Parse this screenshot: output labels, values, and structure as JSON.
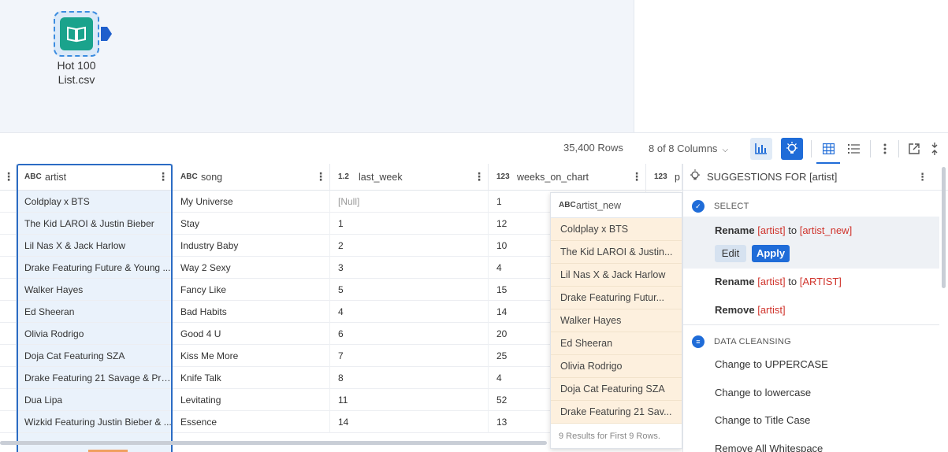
{
  "canvas": {
    "tool": {
      "label": "Hot 100\nList.csv",
      "icon": "book-open-icon"
    }
  },
  "toolbar": {
    "rows": "35,400 Rows",
    "columns": "8 of 8 Columns",
    "icons": [
      "bar-chart-icon",
      "lightbulb-icon",
      "grid-view-icon",
      "list-view-icon",
      "more-icon",
      "pop-out-icon",
      "collapse-icon"
    ]
  },
  "grid": {
    "headers": [
      {
        "type": "ABC",
        "name": "artist"
      },
      {
        "type": "ABC",
        "name": "song"
      },
      {
        "type": "1.2",
        "name": "last_week"
      },
      {
        "type": "123",
        "name": "weeks_on_chart"
      },
      {
        "type": "123",
        "name": "p"
      }
    ],
    "rows": [
      [
        "Coldplay x BTS",
        "My Universe",
        "[Null]",
        "1"
      ],
      [
        "The Kid LAROI & Justin Bieber",
        "Stay",
        "1",
        "12"
      ],
      [
        "Lil Nas X & Jack Harlow",
        "Industry Baby",
        "2",
        "10"
      ],
      [
        "Drake Featuring Future & Young ...",
        "Way 2 Sexy",
        "3",
        "4"
      ],
      [
        "Walker Hayes",
        "Fancy Like",
        "5",
        "15"
      ],
      [
        "Ed Sheeran",
        "Bad Habits",
        "4",
        "14"
      ],
      [
        "Olivia Rodrigo",
        "Good 4 U",
        "6",
        "20"
      ],
      [
        "Doja Cat Featuring SZA",
        "Kiss Me More",
        "7",
        "25"
      ],
      [
        "Drake Featuring 21 Savage & Pro...",
        "Knife Talk",
        "8",
        "4"
      ],
      [
        "Dua Lipa",
        "Levitating",
        "11",
        "52"
      ],
      [
        "Wizkid Featuring Justin Bieber & ...",
        "Essence",
        "14",
        "13"
      ]
    ]
  },
  "preview": {
    "type": "ABC",
    "header": "artist_new",
    "values": [
      "Coldplay x BTS",
      "The Kid LAROI & Justin...",
      "Lil Nas X & Jack Harlow",
      "Drake Featuring Futur...",
      "Walker Hayes",
      "Ed Sheeran",
      "Olivia Rodrigo",
      "Doja Cat Featuring SZA",
      "Drake Featuring 21 Sav..."
    ],
    "footer": "9 Results for First 9 Rows."
  },
  "suggestions": {
    "title": "SUGGESTIONS FOR [artist]",
    "select_title": "SELECT",
    "rename1": {
      "verb": "Rename",
      "from": "[artist]",
      "to_word": "to",
      "to": "[artist_new]"
    },
    "edit_label": "Edit",
    "apply_label": "Apply",
    "rename2": {
      "verb": "Rename",
      "from": "[artist]",
      "to_word": "to",
      "to": "[ARTIST]"
    },
    "remove": {
      "verb": "Remove",
      "target": "[artist]"
    },
    "cleansing_title": "DATA CLEANSING",
    "cleansing_items": [
      "Change to UPPERCASE",
      "Change to lowercase",
      "Change to Title Case",
      "Remove All Whitespace"
    ]
  }
}
